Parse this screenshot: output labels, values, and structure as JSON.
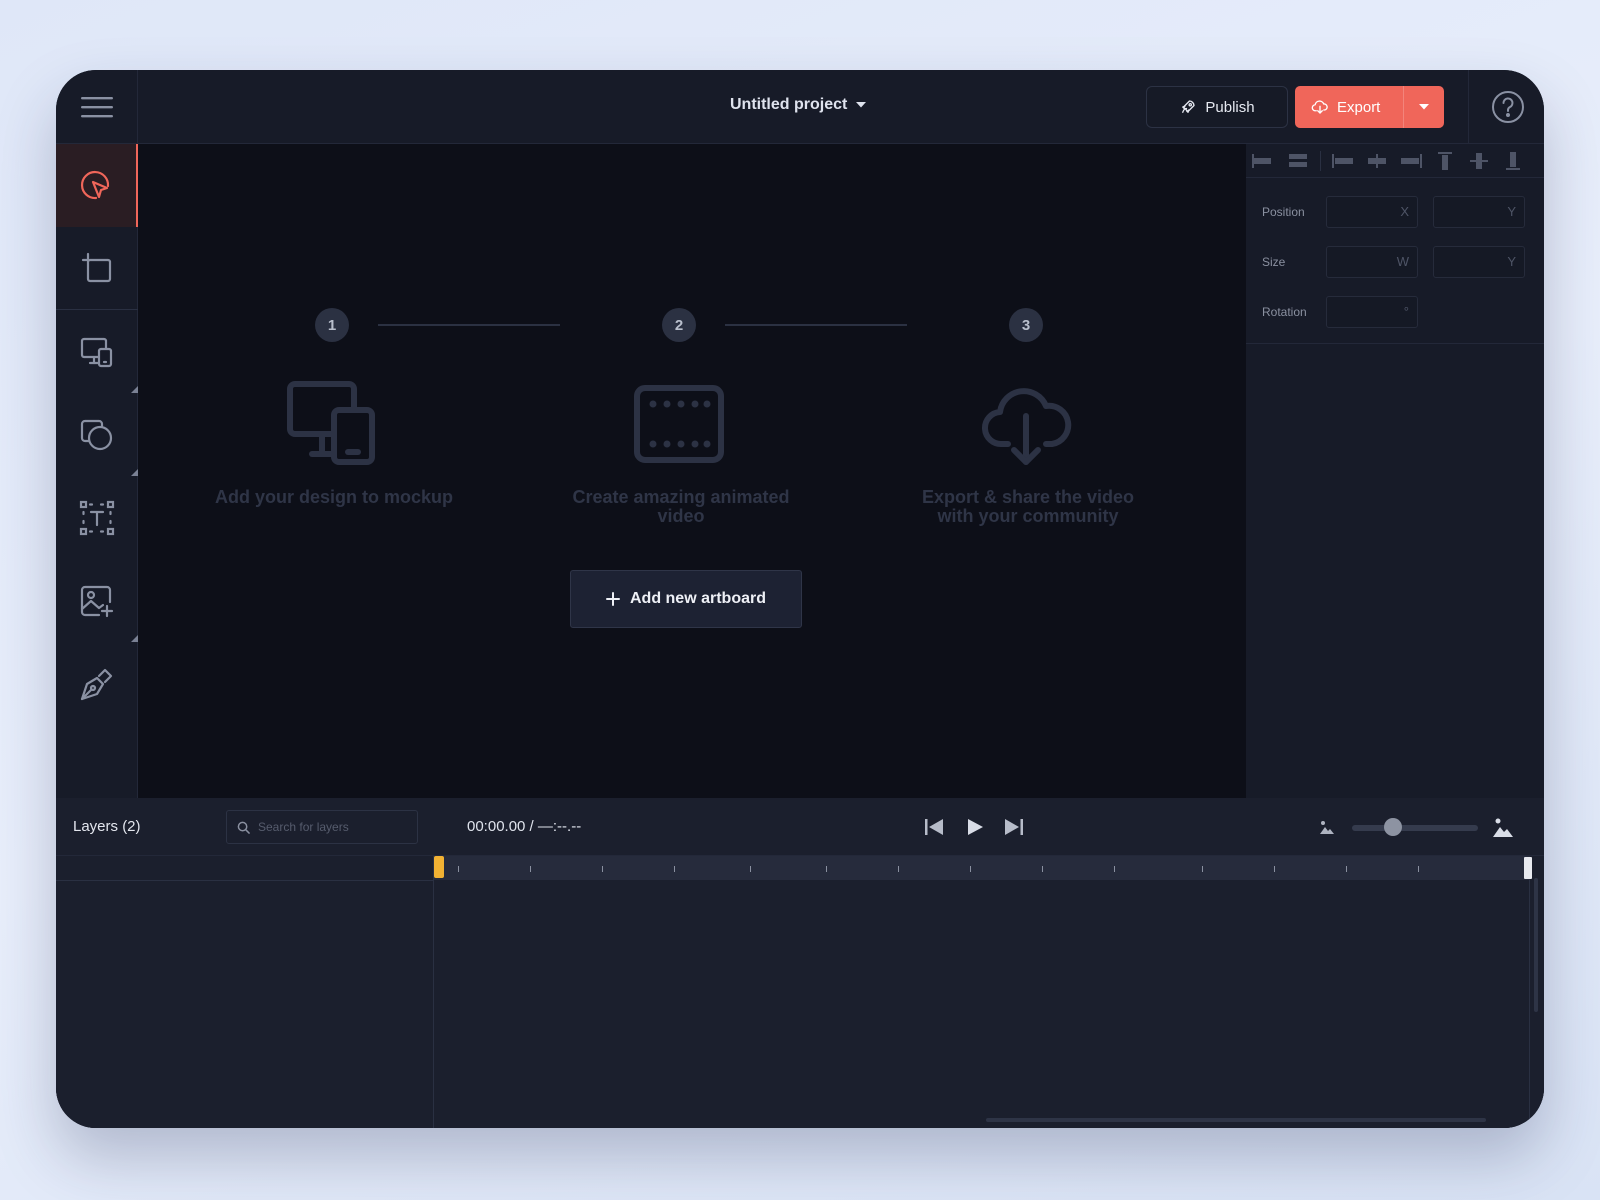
{
  "header": {
    "project_title": "Untitled project",
    "publish_label": "Publish",
    "export_label": "Export"
  },
  "toolbar": {
    "tools": [
      "select-tool",
      "artboard-tool",
      "mockup-tool",
      "shapes-tool",
      "text-tool",
      "image-tool",
      "pen-tool"
    ]
  },
  "canvas": {
    "steps": [
      {
        "number": "1",
        "text": "Add your design to mockup"
      },
      {
        "number": "2",
        "text": "Create amazing animated video"
      },
      {
        "number": "3",
        "text": "Export & share the video with your community"
      }
    ],
    "add_artboard_label": "Add new artboard"
  },
  "panel": {
    "position_label": "Position",
    "size_label": "Size",
    "rotation_label": "Rotation",
    "position_x_placeholder": "X",
    "position_y_placeholder": "Y",
    "size_w_placeholder": "W",
    "size_h_placeholder": "Y",
    "rotation_placeholder": "°"
  },
  "timeline": {
    "layers_title": "Layers (2)",
    "search_placeholder": "Search for layers",
    "timecode": "00:00.00 / —:--.--",
    "zoom_level": 0.3
  },
  "colors": {
    "accent": "#f0665a",
    "playhead": "#f2b233",
    "background": "#161a27"
  }
}
